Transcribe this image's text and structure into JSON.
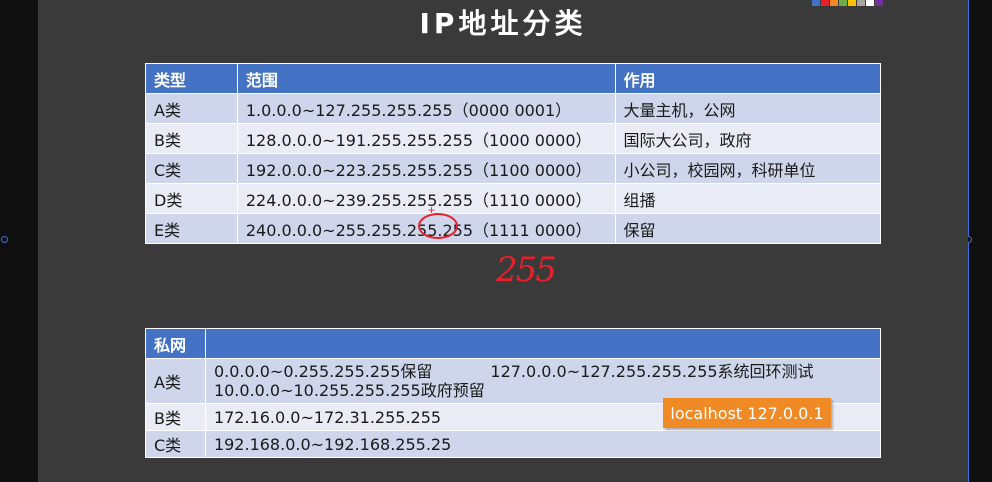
{
  "slide": {
    "title": "IP地址分类"
  },
  "table1": {
    "headers": [
      "类型",
      "范围",
      "作用"
    ],
    "rows": [
      {
        "type": "A类",
        "range": "1.0.0.0~127.255.255.255（0000 0001）",
        "use": "大量主机，公网"
      },
      {
        "type": "B类",
        "range": "128.0.0.0~191.255.255.255（1000 0000）",
        "use": "国际大公司，政府"
      },
      {
        "type": "C类",
        "range": "192.0.0.0~223.255.255.255（1100 0000）",
        "use": "小公司，校园网，科研单位"
      },
      {
        "type": "D类",
        "range": "224.0.0.0~239.255.255.255（1110 0000）",
        "use": "组播"
      },
      {
        "type": "E类",
        "range": "240.0.0.0~255.255.255.255（1111 0000）",
        "use": "保留"
      }
    ]
  },
  "annotation": {
    "handwritten": "255"
  },
  "table2": {
    "header": "私网",
    "rows": [
      {
        "type": "A类",
        "line1a": "0.0.0.0~0.255.255.255保留",
        "line1b": "127.0.0.0~127.255.255.255系统回环测试",
        "line2": "10.0.0.0~10.255.255.255政府预留"
      },
      {
        "type": "B类",
        "range": "172.16.0.0~172.31.255.255"
      },
      {
        "type": "C类",
        "range": "192.168.0.0~192.168.255.25"
      }
    ]
  },
  "callout": {
    "text": "localhost  127.0.0.1"
  },
  "colors": {
    "header_blue": "#4472c4",
    "row_odd": "#cfd5ea",
    "row_even": "#e9ebf5",
    "annotation_red": "#e8202a",
    "callout_orange": "#f08a24"
  }
}
